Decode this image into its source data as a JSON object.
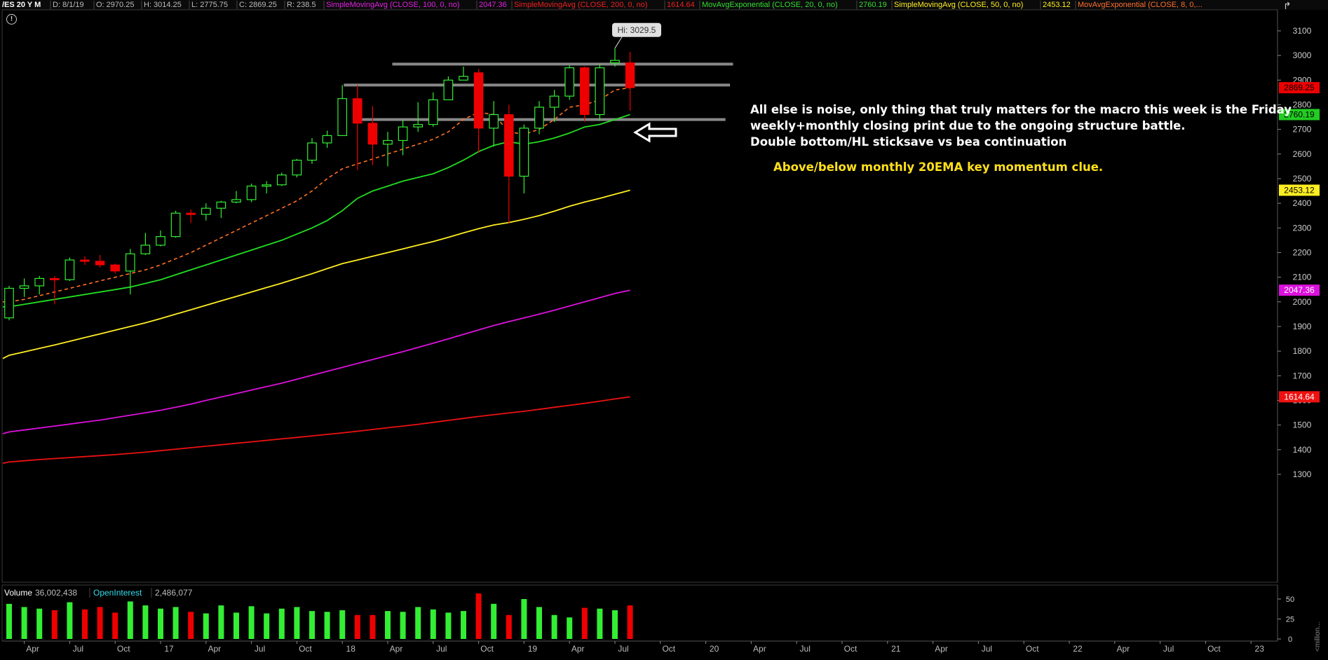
{
  "header": {
    "symbol": "/ES 20 Y M",
    "items": [
      {
        "text": "D: 8/1/19",
        "color": "#bbbbbb"
      },
      {
        "text": "O: 2970.25",
        "color": "#bbbbbb"
      },
      {
        "text": "H: 3014.25",
        "color": "#bbbbbb"
      },
      {
        "text": "L: 2775.75",
        "color": "#bbbbbb"
      },
      {
        "text": "C: 2869.25",
        "color": "#bbbbbb"
      },
      {
        "text": "R: 238.5",
        "color": "#bbbbbb"
      },
      {
        "text": "SimpleMovingAvg (CLOSE, 100, 0, no)",
        "color": "#e020e0"
      },
      {
        "text": "2047.36",
        "color": "#e020e0"
      },
      {
        "text": "SimpleMovingAvg (CLOSE, 200, 0, no)",
        "color": "#ee2020"
      },
      {
        "text": "1614.64",
        "color": "#ee2020"
      },
      {
        "text": "MovAvgExponential (CLOSE, 20, 0, no)",
        "color": "#33dd33"
      },
      {
        "text": "2760.19",
        "color": "#33dd33"
      },
      {
        "text": "SimpleMovingAvg (CLOSE, 50, 0, no)",
        "color": "#ffee22"
      },
      {
        "text": "2453.12",
        "color": "#ffee22"
      },
      {
        "text": "MovAvgExponential (CLOSE, 8, 0,...",
        "color": "#ff7030"
      }
    ]
  },
  "annotations": {
    "hi_label": "Hi: 3029.5",
    "note_lines": [
      "All else is noise, only thing that truly matters for the macro this week is the Friday",
      "weekly+monthly closing print due to the ongoing structure battle.",
      "Double bottom/HL sticksave vs bea continuation"
    ],
    "ema_note": "Above/below monthly 20EMA key momentum clue."
  },
  "volume_header": {
    "volume_label": "Volume",
    "volume_value": "36,002,438",
    "oi_label": "OpenInterest",
    "oi_value": "2,486,077"
  },
  "volume_axis_unit": "<million...",
  "colors": {
    "up": "#33ee33",
    "down": "#ee0000",
    "ema20": "#22dd22",
    "sma50": "#ffee22",
    "sma100": "#dd11dd",
    "sma200": "#ee1111",
    "ema8": "#ff7020",
    "level": "#888888"
  },
  "chart_data": {
    "type": "candlestick",
    "timeframe": "monthly",
    "ylim": [
      1270,
      3170
    ],
    "y_ticks": [
      1300,
      1400,
      1500,
      1600,
      1700,
      1800,
      1900,
      2000,
      2100,
      2200,
      2300,
      2400,
      2500,
      2600,
      2700,
      2800,
      2900,
      3000,
      3100
    ],
    "x_tick_labels": [
      "Apr",
      "Jul",
      "Oct",
      "17",
      "Apr",
      "Jul",
      "Oct",
      "18",
      "Apr",
      "Jul",
      "Oct",
      "19",
      "Apr",
      "Jul",
      "Oct",
      "20",
      "Apr",
      "Jul",
      "Oct",
      "21",
      "Apr",
      "Jul",
      "Oct",
      "22",
      "Apr",
      "Jul",
      "Oct",
      "23"
    ],
    "x_tick_index": [
      1,
      4,
      7,
      10,
      13,
      16,
      19,
      22,
      25,
      28,
      31,
      34,
      37,
      40,
      43,
      46,
      49,
      52,
      55,
      58,
      61,
      64,
      67,
      70,
      73,
      76,
      79,
      82
    ],
    "candles": [
      {
        "o": 1935,
        "h": 2065,
        "l": 1925,
        "c": 2055
      },
      {
        "o": 2055,
        "h": 2095,
        "l": 2020,
        "c": 2065
      },
      {
        "o": 2065,
        "h": 2105,
        "l": 2030,
        "c": 2095
      },
      {
        "o": 2095,
        "h": 2105,
        "l": 1990,
        "c": 2090
      },
      {
        "o": 2090,
        "h": 2180,
        "l": 2085,
        "c": 2170
      },
      {
        "o": 2170,
        "h": 2185,
        "l": 2150,
        "c": 2165
      },
      {
        "o": 2165,
        "h": 2190,
        "l": 2140,
        "c": 2150
      },
      {
        "o": 2150,
        "h": 2155,
        "l": 2115,
        "c": 2125
      },
      {
        "o": 2125,
        "h": 2215,
        "l": 2030,
        "c": 2195
      },
      {
        "o": 2195,
        "h": 2280,
        "l": 2190,
        "c": 2230
      },
      {
        "o": 2230,
        "h": 2290,
        "l": 2225,
        "c": 2265
      },
      {
        "o": 2265,
        "h": 2370,
        "l": 2260,
        "c": 2360
      },
      {
        "o": 2360,
        "h": 2375,
        "l": 2320,
        "c": 2355
      },
      {
        "o": 2355,
        "h": 2400,
        "l": 2330,
        "c": 2380
      },
      {
        "o": 2380,
        "h": 2410,
        "l": 2340,
        "c": 2405
      },
      {
        "o": 2405,
        "h": 2450,
        "l": 2400,
        "c": 2415
      },
      {
        "o": 2415,
        "h": 2480,
        "l": 2405,
        "c": 2470
      },
      {
        "o": 2470,
        "h": 2490,
        "l": 2440,
        "c": 2475
      },
      {
        "o": 2475,
        "h": 2525,
        "l": 2470,
        "c": 2515
      },
      {
        "o": 2515,
        "h": 2580,
        "l": 2505,
        "c": 2575
      },
      {
        "o": 2575,
        "h": 2665,
        "l": 2560,
        "c": 2645
      },
      {
        "o": 2645,
        "h": 2695,
        "l": 2625,
        "c": 2675
      },
      {
        "o": 2675,
        "h": 2880,
        "l": 2675,
        "c": 2825
      },
      {
        "o": 2825,
        "h": 2880,
        "l": 2535,
        "c": 2725
      },
      {
        "o": 2725,
        "h": 2795,
        "l": 2555,
        "c": 2640
      },
      {
        "o": 2640,
        "h": 2690,
        "l": 2550,
        "c": 2655
      },
      {
        "o": 2655,
        "h": 2740,
        "l": 2595,
        "c": 2710
      },
      {
        "o": 2710,
        "h": 2810,
        "l": 2690,
        "c": 2720
      },
      {
        "o": 2720,
        "h": 2850,
        "l": 2710,
        "c": 2820
      },
      {
        "o": 2820,
        "h": 2915,
        "l": 2820,
        "c": 2900
      },
      {
        "o": 2900,
        "h": 2955,
        "l": 2900,
        "c": 2915
      },
      {
        "o": 2930,
        "h": 2945,
        "l": 2605,
        "c": 2705
      },
      {
        "o": 2705,
        "h": 2815,
        "l": 2630,
        "c": 2760
      },
      {
        "o": 2760,
        "h": 2800,
        "l": 2320,
        "c": 2510
      },
      {
        "o": 2510,
        "h": 2720,
        "l": 2440,
        "c": 2705
      },
      {
        "o": 2705,
        "h": 2815,
        "l": 2680,
        "c": 2790
      },
      {
        "o": 2790,
        "h": 2860,
        "l": 2730,
        "c": 2835
      },
      {
        "o": 2835,
        "h": 2960,
        "l": 2820,
        "c": 2950
      },
      {
        "o": 2950,
        "h": 2955,
        "l": 2730,
        "c": 2760
      },
      {
        "o": 2760,
        "h": 2965,
        "l": 2735,
        "c": 2950
      },
      {
        "o": 2970,
        "h": 3029.5,
        "l": 2955,
        "c": 2980
      },
      {
        "o": 2970.25,
        "h": 3014.25,
        "l": 2775.75,
        "c": 2869.25
      }
    ],
    "series": [
      {
        "name": "SimpleMovingAvg (CLOSE, 100, 0, no)",
        "last": 2047.36,
        "values": [
          1465,
          1472,
          1480,
          1488,
          1496,
          1504,
          1512,
          1520,
          1530,
          1540,
          1550,
          1560,
          1572,
          1585,
          1600,
          1614,
          1628,
          1642,
          1656,
          1670,
          1686,
          1702,
          1718,
          1734,
          1750,
          1766,
          1782,
          1798,
          1815,
          1832,
          1850,
          1868,
          1886,
          1904,
          1920,
          1935,
          1950,
          1966,
          1983,
          2000,
          2017,
          2034,
          2047.36
        ]
      },
      {
        "name": "SimpleMovingAvg (CLOSE, 200, 0, no)",
        "last": 1614.64,
        "values": [
          1345,
          1350,
          1355,
          1360,
          1364,
          1368,
          1372,
          1376,
          1380,
          1385,
          1390,
          1396,
          1402,
          1408,
          1414,
          1420,
          1426,
          1432,
          1438,
          1444,
          1450,
          1456,
          1462,
          1468,
          1475,
          1482,
          1489,
          1496,
          1503,
          1511,
          1519,
          1527,
          1535,
          1542,
          1549,
          1556,
          1564,
          1572,
          1580,
          1588,
          1597,
          1606,
          1614.64
        ]
      },
      {
        "name": "MovAvgExponential (CLOSE, 20, 0, no)",
        "last": 2760.19,
        "values": [
          1980,
          1990,
          2000,
          2010,
          2020,
          2030,
          2040,
          2050,
          2060,
          2075,
          2090,
          2110,
          2130,
          2150,
          2170,
          2190,
          2210,
          2230,
          2250,
          2275,
          2300,
          2330,
          2370,
          2420,
          2450,
          2470,
          2490,
          2505,
          2520,
          2545,
          2575,
          2610,
          2635,
          2650,
          2640,
          2650,
          2665,
          2685,
          2710,
          2720,
          2740,
          2760.19
        ]
      },
      {
        "name": "SimpleMovingAvg (CLOSE, 50, 0, no)",
        "last": 2453.12,
        "values": [
          1770,
          1783,
          1797,
          1811,
          1825,
          1840,
          1855,
          1870,
          1885,
          1900,
          1915,
          1932,
          1950,
          1968,
          1986,
          2004,
          2022,
          2040,
          2058,
          2076,
          2095,
          2114,
          2135,
          2155,
          2170,
          2185,
          2200,
          2215,
          2230,
          2245,
          2262,
          2280,
          2297,
          2312,
          2322,
          2335,
          2350,
          2368,
          2388,
          2405,
          2420,
          2437,
          2453.12
        ]
      },
      {
        "name": "MovAvgExponential (CLOSE, 8, 0,...",
        "values": [
          2000,
          2010,
          2025,
          2040,
          2055,
          2070,
          2085,
          2100,
          2115,
          2130,
          2150,
          2175,
          2200,
          2230,
          2260,
          2290,
          2320,
          2350,
          2380,
          2410,
          2450,
          2500,
          2540,
          2560,
          2580,
          2600,
          2620,
          2640,
          2660,
          2690,
          2740,
          2770,
          2760,
          2690,
          2680,
          2700,
          2740,
          2790,
          2800,
          2820,
          2860,
          2869
        ]
      }
    ],
    "levels": [
      {
        "value": 2965,
        "from": 25.3,
        "to": 47.8
      },
      {
        "value": 2880,
        "from": 22.1,
        "to": 47.6
      },
      {
        "value": 2740,
        "from": 23.2,
        "to": 47.3
      }
    ],
    "price_tags": [
      {
        "value": 2869.25,
        "label": "2869.25",
        "bg": "#ee0000",
        "fg": "#000000"
      },
      {
        "value": 2760.19,
        "label": "2760.19",
        "bg": "#22cc22",
        "fg": "#000000"
      },
      {
        "value": 2453.12,
        "label": "2453.12",
        "bg": "#ffee22",
        "fg": "#000000"
      },
      {
        "value": 2047.36,
        "label": "2047.36",
        "bg": "#dd11dd",
        "fg": "#ffffff"
      },
      {
        "value": 1614.64,
        "label": "1614.64",
        "bg": "#ee1111",
        "fg": "#ffffff"
      }
    ],
    "volume": {
      "ylim": [
        0,
        55
      ],
      "ticks": [
        0,
        25,
        50
      ],
      "values": [
        44,
        40,
        38,
        36,
        46,
        37,
        40,
        33,
        47,
        42,
        38,
        40,
        34,
        32,
        42,
        33,
        41,
        32,
        38,
        40,
        35,
        34,
        36,
        30,
        30,
        35,
        34,
        40,
        37,
        33,
        35,
        57,
        44,
        30,
        50,
        40,
        30,
        27,
        39,
        38,
        36,
        42
      ]
    }
  }
}
